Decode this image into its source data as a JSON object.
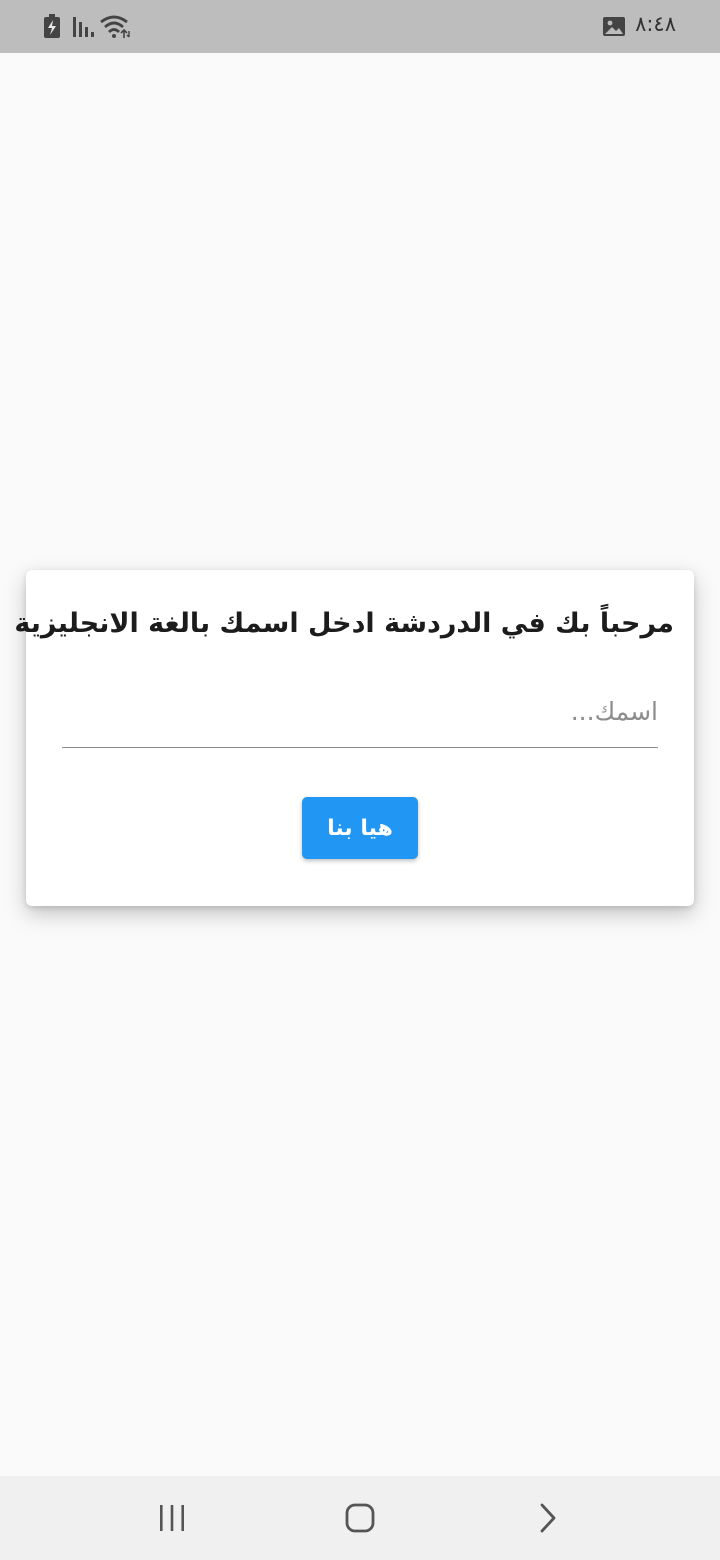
{
  "status_bar": {
    "time": "٨:٤٨",
    "icons": [
      "battery-charging-icon",
      "signal-icon",
      "wifi-icon",
      "image-notification-icon"
    ]
  },
  "dialog": {
    "title": "مرحباً بك في الدردشة ادخل اسمك بالغة الانجليزية",
    "name_input": {
      "placeholder": "اسمك...",
      "value": ""
    },
    "submit_label": "هيا بنا"
  },
  "nav_bar": {
    "buttons": [
      "recent-apps-icon",
      "home-icon",
      "back-icon"
    ]
  },
  "colors": {
    "accent": "#2196f3",
    "status_bar": "#bdbdbd",
    "background": "#fafafa",
    "nav_bar": "#f0f0f0"
  }
}
